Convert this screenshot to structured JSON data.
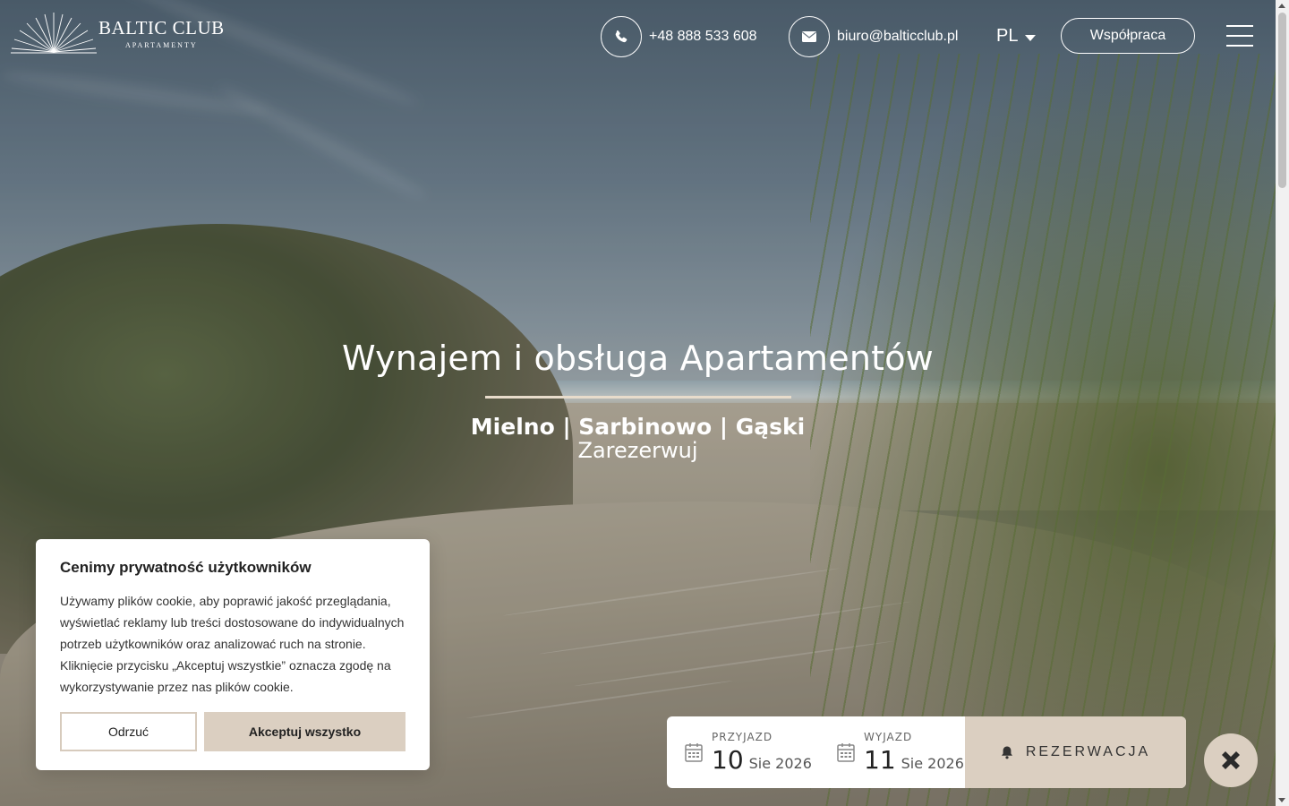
{
  "brand": {
    "name": "BALTIC CLUB",
    "sub": "APARTAMENTY"
  },
  "header": {
    "phone": "+48 888 533 608",
    "email": "biuro@balticclub.pl",
    "language": "PL",
    "cooperation_label": "Współpraca"
  },
  "hero": {
    "title": "Wynajem i obsługa Apartamentów",
    "cities": "Mielno | Sarbinowo | Gąski",
    "book_link": "Zarezerwuj"
  },
  "cookie": {
    "title": "Cenimy prywatność użytkowników",
    "body": "Używamy plików cookie, aby poprawić jakość przeglądania, wyświetlać reklamy lub treści dostosowane do indywidualnych potrzeb użytkowników oraz analizować ruch na stronie. Kliknięcie przycisku „Akceptuj wszystkie” oznacza zgodę na wykorzystywanie przez nas plików cookie.",
    "reject_label": "Odrzuć",
    "accept_label": "Akceptuj wszystko"
  },
  "booking": {
    "arrival": {
      "label": "PRZYJAZD",
      "day": "10",
      "month_year": "Sie 2026"
    },
    "departure": {
      "label": "WYJAZD",
      "day": "11",
      "month_year": "Sie 2026"
    },
    "reserve_label": "REZERWACJA"
  },
  "colors": {
    "accent": "#dbcfc1",
    "line": "#e8dccb",
    "white": "#ffffff"
  },
  "icons": [
    "phone-icon",
    "mail-icon",
    "caret-down-icon",
    "menu-icon",
    "calendar-icon",
    "bell-icon",
    "close-icon",
    "sunrise-logo-icon"
  ]
}
